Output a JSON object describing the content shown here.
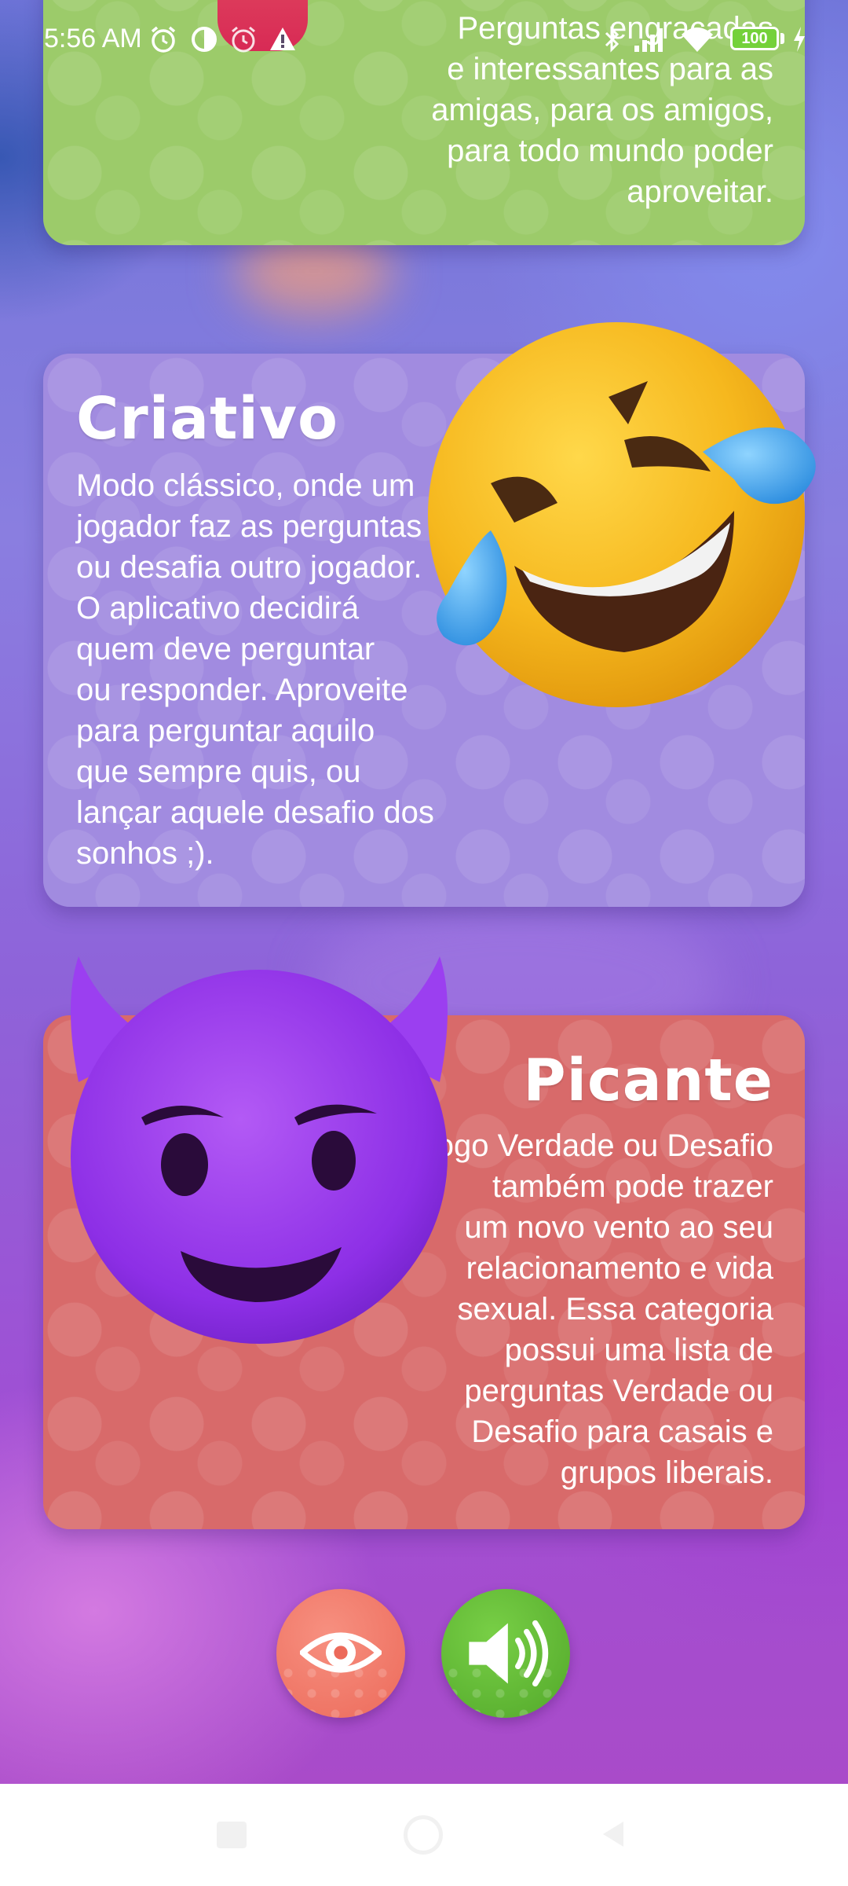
{
  "status_bar": {
    "time": "5:56 AM",
    "battery": "100"
  },
  "cards": {
    "top": {
      "desc_lines": [
        "Perguntas engraçadas",
        "e interessantes para as",
        "amigas, para os amigos,",
        "para todo mundo poder",
        "aproveitar."
      ]
    },
    "criativo": {
      "title": "Criativo",
      "desc_lines": [
        "Modo clássico, onde um",
        "jogador faz as perguntas",
        "ou desafia outro jogador.",
        "O aplicativo decidirá",
        "quem deve perguntar",
        "ou responder. Aproveite",
        "para perguntar aquilo",
        "que sempre quis, ou",
        "lançar aquele desafio dos",
        "sonhos ;)."
      ]
    },
    "picante": {
      "title": "Picante",
      "desc_lines": [
        "O jogo Verdade ou Desafio",
        "também pode trazer",
        "um novo vento ao seu",
        "relacionamento e vida",
        "sexual. Essa categoria",
        "possui uma lista de",
        "perguntas Verdade ou",
        "Desafio para casais e",
        "grupos liberais."
      ]
    }
  },
  "colors": {
    "top_card": "#9ccb6a",
    "criativo_card": "#a18be0",
    "picante_card": "#d86a6a",
    "eye_button": "#f0786a",
    "sound_button": "#62b832"
  },
  "icons": {
    "criativo_emoji": "rolling-laughing-emoji",
    "picante_emoji": "smiling-devil-emoji",
    "eye": "eye-icon",
    "sound": "speaker-icon"
  }
}
